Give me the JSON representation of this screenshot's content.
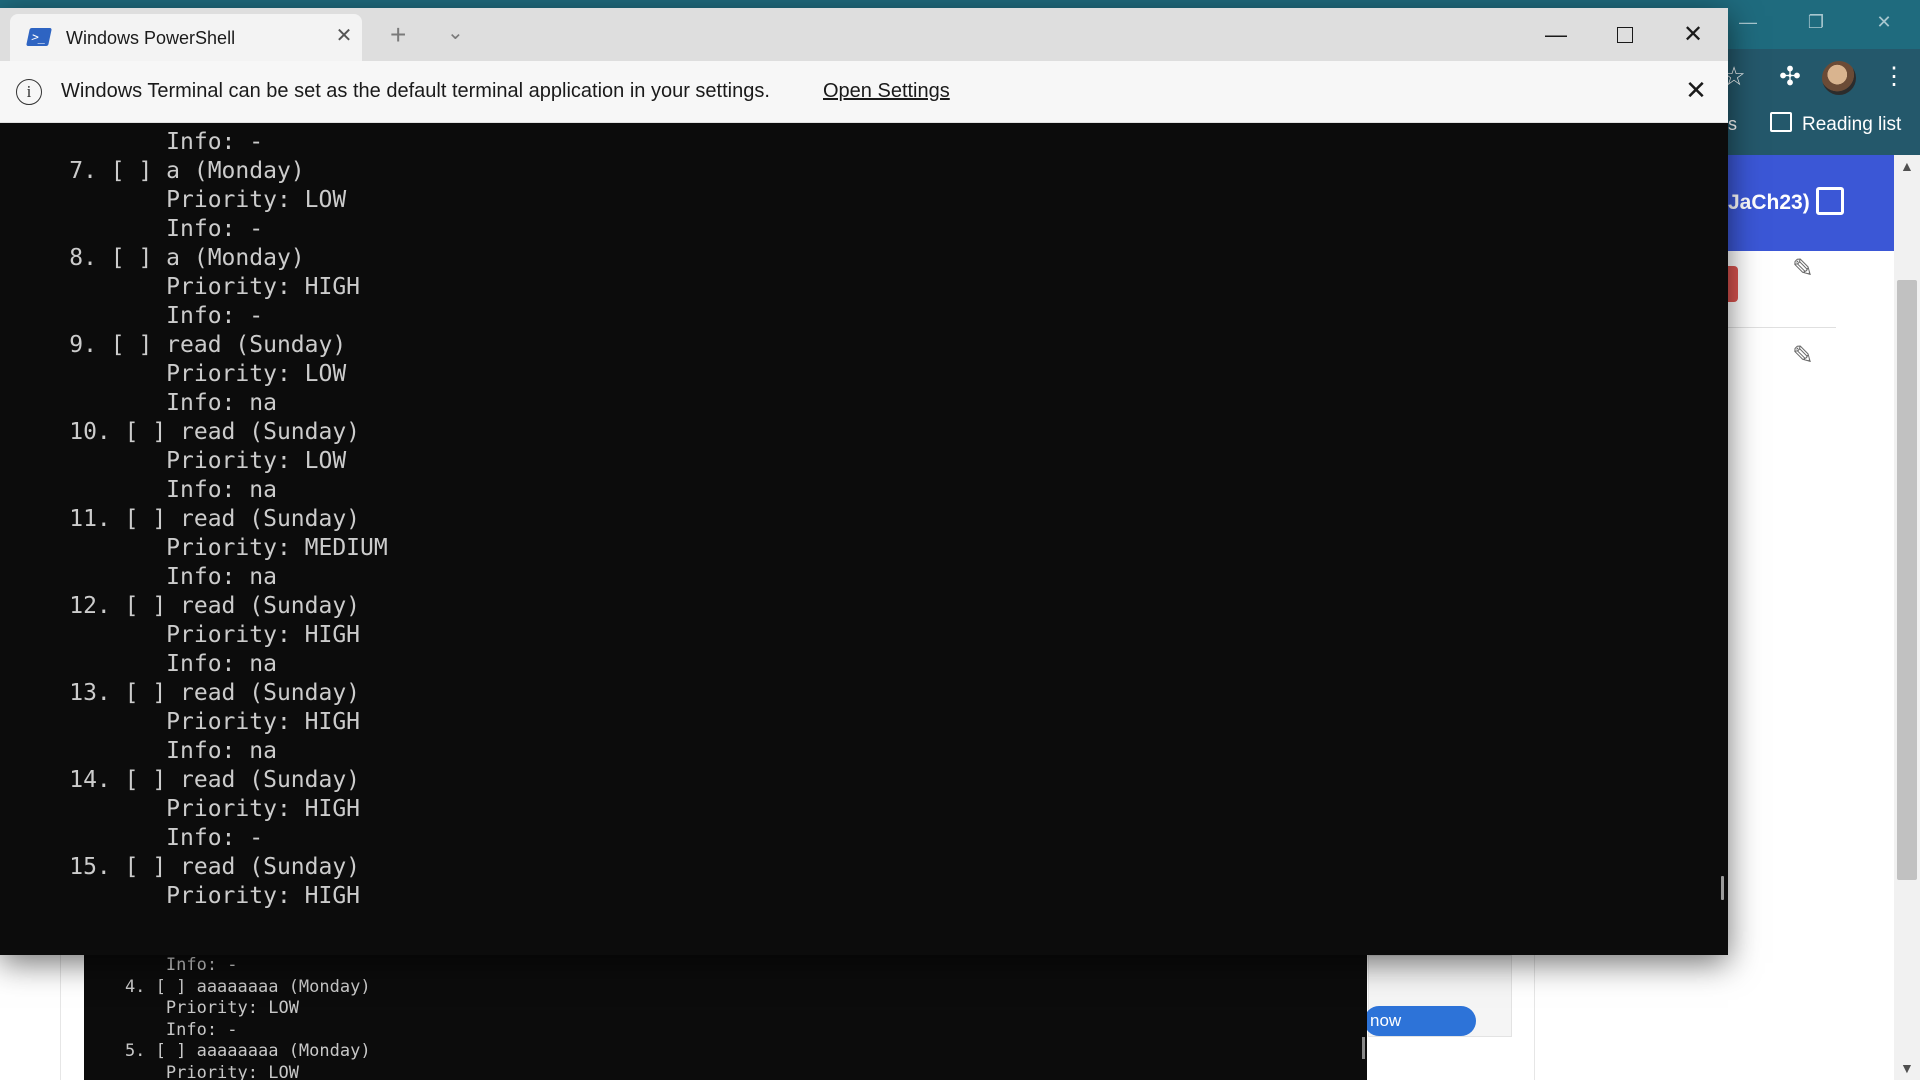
{
  "browser": {
    "reading_list_label": "Reading list",
    "toolbar_edge_text": "s",
    "header_text": "JaCh23)",
    "blue_button_text": "now",
    "window_controls": {
      "minimize": "—",
      "restore": "❐",
      "close": "✕"
    }
  },
  "back_terminal": {
    "lines": [
      "        Info: -",
      "    4. [ ] aaaaaaaa (Monday)",
      "        Priority: LOW",
      "        Info: -",
      "    5. [ ] aaaaaaaa (Monday)",
      "        Priority: LOW"
    ]
  },
  "terminal": {
    "tab_title": "Windows PowerShell",
    "tab_close": "✕",
    "new_tab": "+",
    "dropdown": "⌄",
    "controls": {
      "minimize": "—",
      "close": "✕"
    },
    "infobar": {
      "icon": "i",
      "message": "Windows Terminal can be set as the default terminal application in your settings.",
      "link": "Open Settings",
      "close": "✕"
    },
    "lines": [
      "            Info: -",
      "     7. [ ] a (Monday)",
      "            Priority: LOW",
      "            Info: -",
      "     8. [ ] a (Monday)",
      "            Priority: HIGH",
      "            Info: -",
      "     9. [ ] read (Sunday)",
      "            Priority: LOW",
      "            Info: na",
      "     10. [ ] read (Sunday)",
      "            Priority: LOW",
      "            Info: na",
      "     11. [ ] read (Sunday)",
      "            Priority: MEDIUM",
      "            Info: na",
      "     12. [ ] read (Sunday)",
      "            Priority: HIGH",
      "            Info: na",
      "     13. [ ] read (Sunday)",
      "            Priority: HIGH",
      "            Info: na",
      "     14. [ ] read (Sunday)",
      "            Priority: HIGH",
      "            Info: -",
      "     15. [ ] read (Sunday)",
      "            Priority: HIGH"
    ]
  }
}
